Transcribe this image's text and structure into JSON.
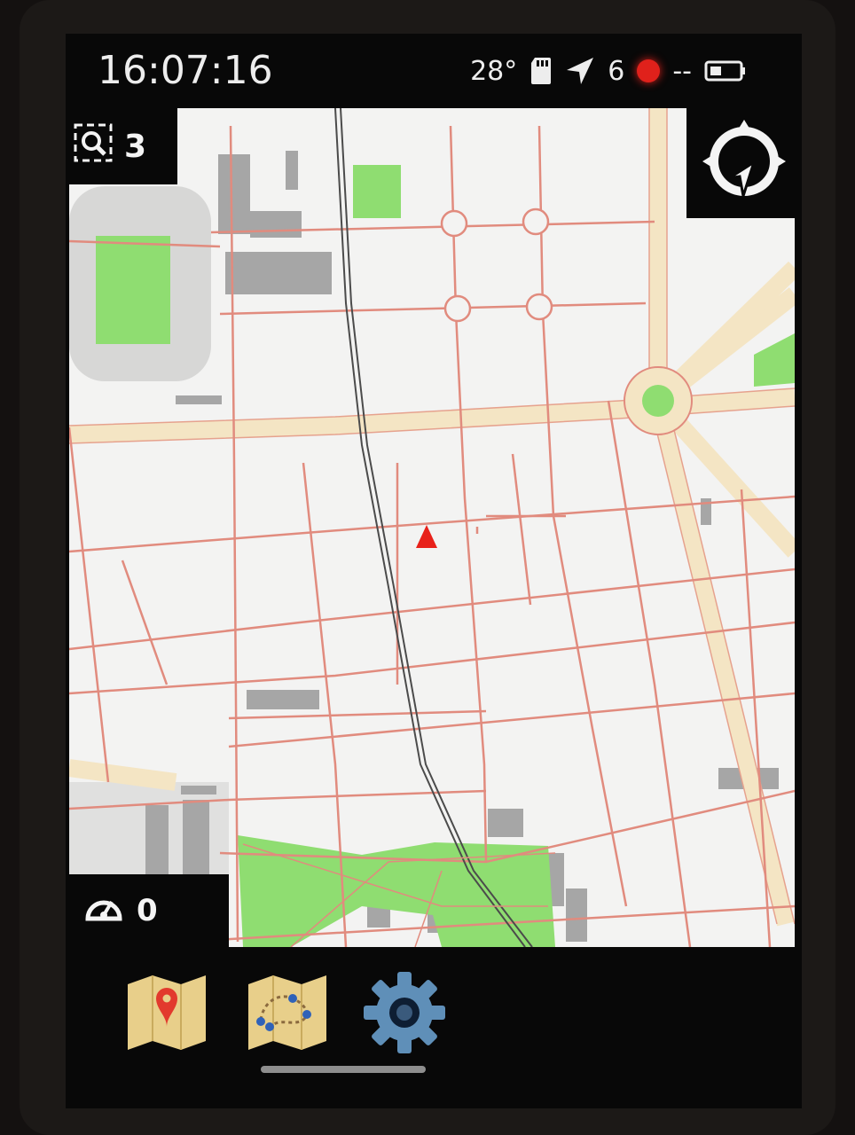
{
  "status_bar": {
    "time": "16:07:16",
    "temperature": "28°",
    "satellites": "6",
    "signal": "--",
    "icons": [
      "sd-card-icon",
      "gps-arrow-icon",
      "recording-dot-icon",
      "battery-icon"
    ]
  },
  "map": {
    "zoom_badge": {
      "icon": "zoom-magnifier-icon",
      "value": "3"
    },
    "speed_badge": {
      "icon": "speedometer-icon",
      "value": "0"
    },
    "compass_button": {
      "icon": "compass-navigation-icon"
    },
    "position_marker": {
      "icon": "position-arrow-icon"
    }
  },
  "dock": {
    "buttons": [
      {
        "name": "map-pin-button",
        "icon": "map-pin-icon"
      },
      {
        "name": "route-map-button",
        "icon": "route-map-icon"
      },
      {
        "name": "settings-button",
        "icon": "gear-icon"
      }
    ]
  },
  "colors": {
    "road": "#e18b7e",
    "major_road": "#f4e5c4",
    "park": "#8fdd71",
    "building": "#a6a6a6",
    "marker": "#e8211a"
  }
}
